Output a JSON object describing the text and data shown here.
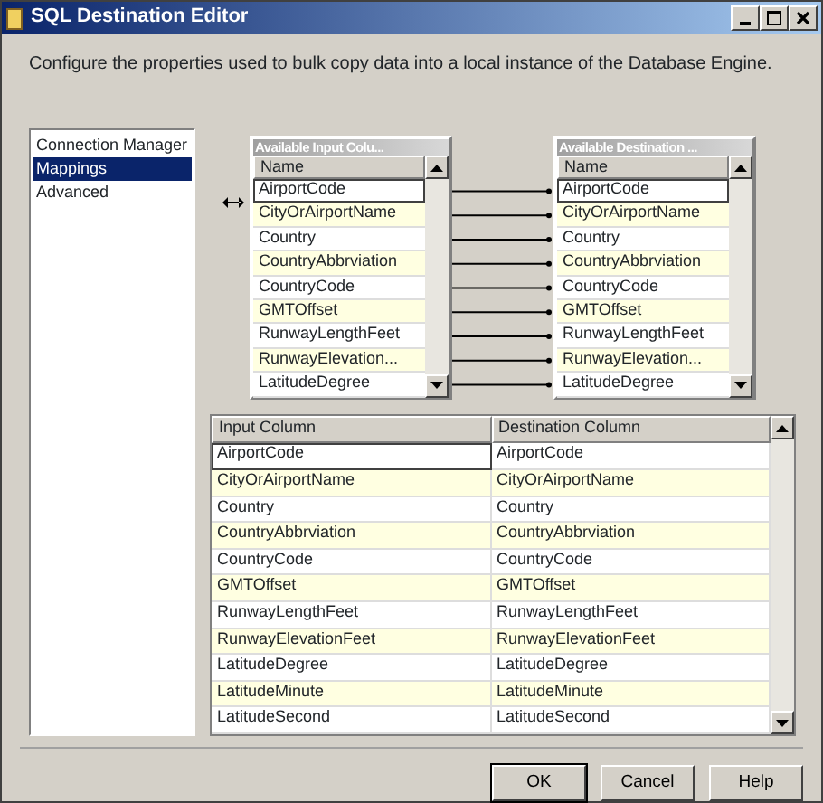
{
  "window": {
    "title": "SQL Destination Editor"
  },
  "description": "Configure the properties used to bulk copy data into a local instance of the Database Engine.",
  "sidebar": {
    "items": [
      {
        "label": "Connection Manager",
        "selected": false
      },
      {
        "label": "Mappings",
        "selected": true
      },
      {
        "label": "Advanced",
        "selected": false
      }
    ]
  },
  "input_columns": {
    "title": "Available Input Colu...",
    "header": "Name",
    "items": [
      {
        "label": "AirportCode",
        "selected": true,
        "mapped": true
      },
      {
        "label": "CityOrAirportName",
        "selected": false,
        "mapped": true
      },
      {
        "label": "Country",
        "selected": false,
        "mapped": true
      },
      {
        "label": "CountryAbbrviation",
        "selected": false,
        "mapped": true
      },
      {
        "label": "CountryCode",
        "selected": false,
        "mapped": true
      },
      {
        "label": "GMTOffset",
        "selected": false,
        "mapped": true
      },
      {
        "label": "RunwayLengthFeet",
        "selected": false,
        "mapped": true
      },
      {
        "label": "RunwayElevation...",
        "selected": false,
        "mapped": true
      },
      {
        "label": "LatitudeDegree",
        "selected": false,
        "mapped": true
      }
    ]
  },
  "destination_columns": {
    "title": "Available Destination ...",
    "header": "Name",
    "items": [
      {
        "label": "AirportCode",
        "selected": true
      },
      {
        "label": "CityOrAirportName",
        "selected": false
      },
      {
        "label": "Country",
        "selected": false
      },
      {
        "label": "CountryAbbrviation",
        "selected": false
      },
      {
        "label": "CountryCode",
        "selected": false
      },
      {
        "label": "GMTOffset",
        "selected": false
      },
      {
        "label": "RunwayLengthFeet",
        "selected": false
      },
      {
        "label": "RunwayElevation...",
        "selected": false
      },
      {
        "label": "LatitudeDegree",
        "selected": false
      }
    ]
  },
  "table": {
    "columns": [
      "Input Column",
      "Destination Column"
    ],
    "rows": [
      {
        "cells": [
          "AirportCode",
          "AirportCode"
        ],
        "selected": true
      },
      {
        "cells": [
          "CityOrAirportName",
          "CityOrAirportName"
        ],
        "selected": false
      },
      {
        "cells": [
          "Country",
          "Country"
        ],
        "selected": false
      },
      {
        "cells": [
          "CountryAbbrviation",
          "CountryAbbrviation"
        ],
        "selected": false
      },
      {
        "cells": [
          "CountryCode",
          "CountryCode"
        ],
        "selected": false
      },
      {
        "cells": [
          "GMTOffset",
          "GMTOffset"
        ],
        "selected": false
      },
      {
        "cells": [
          "RunwayLengthFeet",
          "RunwayLengthFeet"
        ],
        "selected": false
      },
      {
        "cells": [
          "RunwayElevationFeet",
          "RunwayElevationFeet"
        ],
        "selected": false
      },
      {
        "cells": [
          "LatitudeDegree",
          "LatitudeDegree"
        ],
        "selected": false
      },
      {
        "cells": [
          "LatitudeMinute",
          "LatitudeMinute"
        ],
        "selected": false
      },
      {
        "cells": [
          "LatitudeSecond",
          "LatitudeSecond"
        ],
        "selected": false
      }
    ]
  },
  "buttons": [
    {
      "label": "OK",
      "default": true
    },
    {
      "label": "Cancel",
      "default": false
    },
    {
      "label": "Help",
      "default": false
    }
  ]
}
